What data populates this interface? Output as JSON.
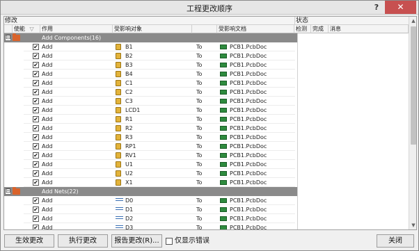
{
  "window": {
    "title": "工程更改顺序",
    "help": "?",
    "close": "✕"
  },
  "grid": {
    "section_modify": "修改",
    "section_status": "状态",
    "columns": {
      "enable": "使能",
      "sort_glyph": "▽",
      "action": "作用",
      "affected_object": "受影响对象",
      "affected_document": "受影响文档",
      "check": "检测",
      "done": "完成",
      "message": "消息"
    }
  },
  "groups": [
    {
      "label": "Add Components(16)",
      "toggle": "⊟",
      "kind": "component",
      "rows": [
        {
          "action": "Add",
          "object": "B1",
          "to": "To",
          "doc": "PCB1.PcbDoc"
        },
        {
          "action": "Add",
          "object": "B2",
          "to": "To",
          "doc": "PCB1.PcbDoc"
        },
        {
          "action": "Add",
          "object": "B3",
          "to": "To",
          "doc": "PCB1.PcbDoc"
        },
        {
          "action": "Add",
          "object": "B4",
          "to": "To",
          "doc": "PCB1.PcbDoc"
        },
        {
          "action": "Add",
          "object": "C1",
          "to": "To",
          "doc": "PCB1.PcbDoc"
        },
        {
          "action": "Add",
          "object": "C2",
          "to": "To",
          "doc": "PCB1.PcbDoc"
        },
        {
          "action": "Add",
          "object": "C3",
          "to": "To",
          "doc": "PCB1.PcbDoc"
        },
        {
          "action": "Add",
          "object": "LCD1",
          "to": "To",
          "doc": "PCB1.PcbDoc"
        },
        {
          "action": "Add",
          "object": "R1",
          "to": "To",
          "doc": "PCB1.PcbDoc"
        },
        {
          "action": "Add",
          "object": "R2",
          "to": "To",
          "doc": "PCB1.PcbDoc"
        },
        {
          "action": "Add",
          "object": "R3",
          "to": "To",
          "doc": "PCB1.PcbDoc"
        },
        {
          "action": "Add",
          "object": "RP1",
          "to": "To",
          "doc": "PCB1.PcbDoc"
        },
        {
          "action": "Add",
          "object": "RV1",
          "to": "To",
          "doc": "PCB1.PcbDoc"
        },
        {
          "action": "Add",
          "object": "U1",
          "to": "To",
          "doc": "PCB1.PcbDoc"
        },
        {
          "action": "Add",
          "object": "U2",
          "to": "To",
          "doc": "PCB1.PcbDoc"
        },
        {
          "action": "Add",
          "object": "X1",
          "to": "To",
          "doc": "PCB1.PcbDoc"
        }
      ]
    },
    {
      "label": "Add Nets(22)",
      "toggle": "⊟",
      "kind": "net",
      "rows": [
        {
          "action": "Add",
          "object": "D0",
          "to": "To",
          "doc": "PCB1.PcbDoc"
        },
        {
          "action": "Add",
          "object": "D1",
          "to": "To",
          "doc": "PCB1.PcbDoc"
        },
        {
          "action": "Add",
          "object": "D2",
          "to": "To",
          "doc": "PCB1.PcbDoc"
        },
        {
          "action": "Add",
          "object": "D3",
          "to": "To",
          "doc": "PCB1.PcbDoc"
        }
      ]
    }
  ],
  "checkmark": "✔",
  "footer": {
    "validate": "生效更改",
    "execute": "执行更改",
    "report": "报告更改(R)...",
    "only_errors": "仅显示错误",
    "close": "关闭"
  },
  "scrollbar": {
    "up": "▲",
    "down": "▼"
  }
}
